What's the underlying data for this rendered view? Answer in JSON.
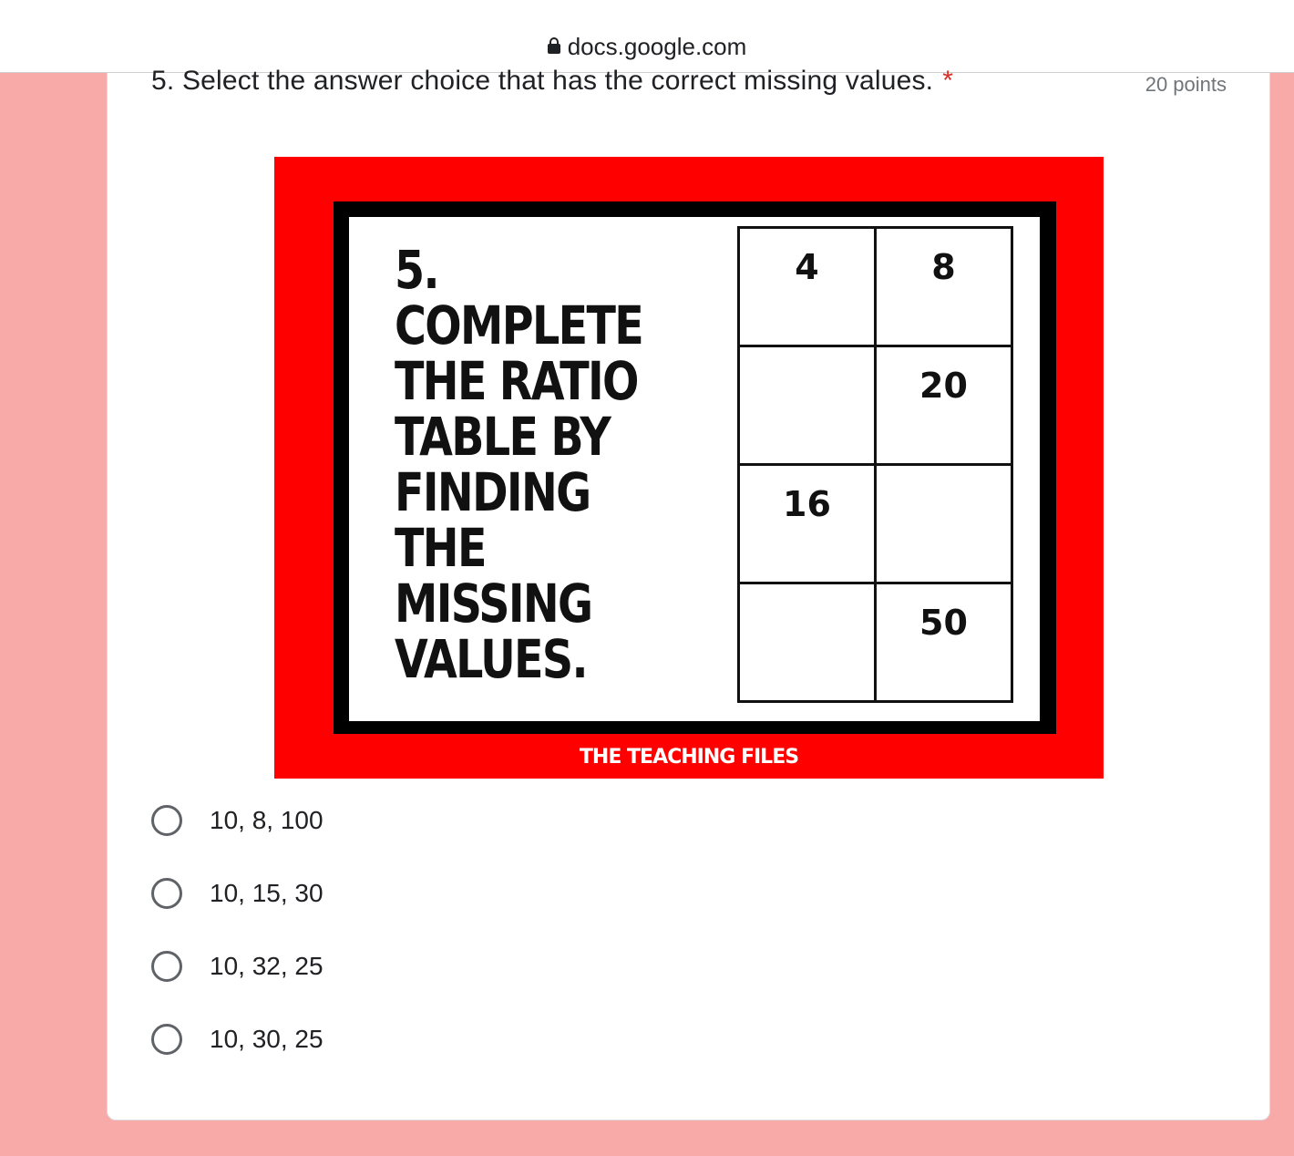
{
  "browser": {
    "url": "docs.google.com"
  },
  "question": {
    "title": "5. Select the answer choice that has the correct missing values.",
    "required_marker": "*",
    "points": "20 points"
  },
  "question_image": {
    "prompt_lines": [
      "5. COMPLETE",
      "THE RATIO",
      "TABLE BY",
      "FINDING THE",
      "MISSING",
      "VALUES."
    ],
    "table": [
      [
        "4",
        "8"
      ],
      [
        "",
        "20"
      ],
      [
        "16",
        ""
      ],
      [
        "",
        "50"
      ]
    ],
    "watermark": "THE TEACHING FILES",
    "colors": {
      "background": "#ff0000",
      "frame": "#000000"
    }
  },
  "options": [
    {
      "label": "10, 8, 100",
      "selected": false
    },
    {
      "label": "10, 15, 30",
      "selected": false
    },
    {
      "label": "10, 32, 25",
      "selected": false
    },
    {
      "label": "10, 30, 25",
      "selected": false
    }
  ],
  "colors": {
    "page_background": "#f8aaa9",
    "card": "#ffffff",
    "required": "#d93025"
  }
}
